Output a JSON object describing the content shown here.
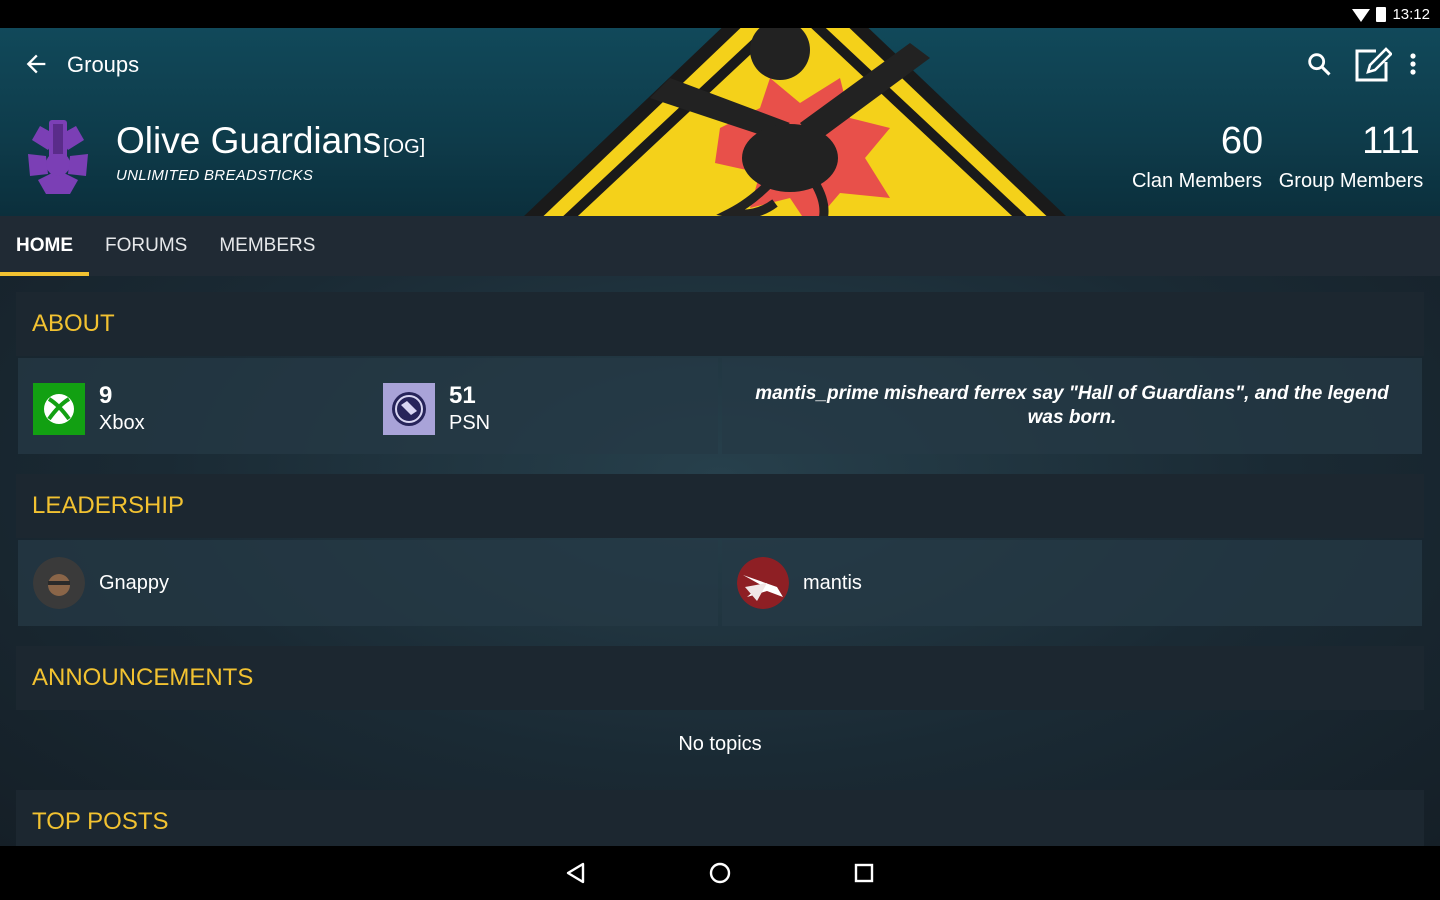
{
  "status_bar": {
    "time": "13:12"
  },
  "app_bar": {
    "title": "Groups"
  },
  "clan": {
    "name": "Olive Guardians",
    "tag": "[OG]",
    "motto": "UNLIMITED BREADSTICKS",
    "stats": [
      {
        "value": "60",
        "label": "Clan Members"
      },
      {
        "value": "111",
        "label": "Group Members"
      }
    ]
  },
  "tabs": [
    {
      "label": "HOME",
      "active": true
    },
    {
      "label": "FORUMS",
      "active": false
    },
    {
      "label": "MEMBERS",
      "active": false
    }
  ],
  "sections": {
    "about": "ABOUT",
    "leadership": "LEADERSHIP",
    "announcements": "ANNOUNCEMENTS",
    "top_posts": "TOP POSTS"
  },
  "about": {
    "platforms": [
      {
        "count": "9",
        "name": "Xbox",
        "icon": "xbox-icon"
      },
      {
        "count": "51",
        "name": "PSN",
        "icon": "psn-icon"
      }
    ],
    "description": "mantis_prime misheard ferrex say \"Hall of Guardians\", and the legend was born."
  },
  "leadership": [
    {
      "name": "Gnappy",
      "icon": "avatar-gnappy"
    },
    {
      "name": "mantis",
      "icon": "avatar-mantis"
    }
  ],
  "announcements": {
    "empty_text": "No topics"
  },
  "colors": {
    "accent": "#f2c231",
    "xbox": "#12a012",
    "psn": "#a9a3d8"
  }
}
